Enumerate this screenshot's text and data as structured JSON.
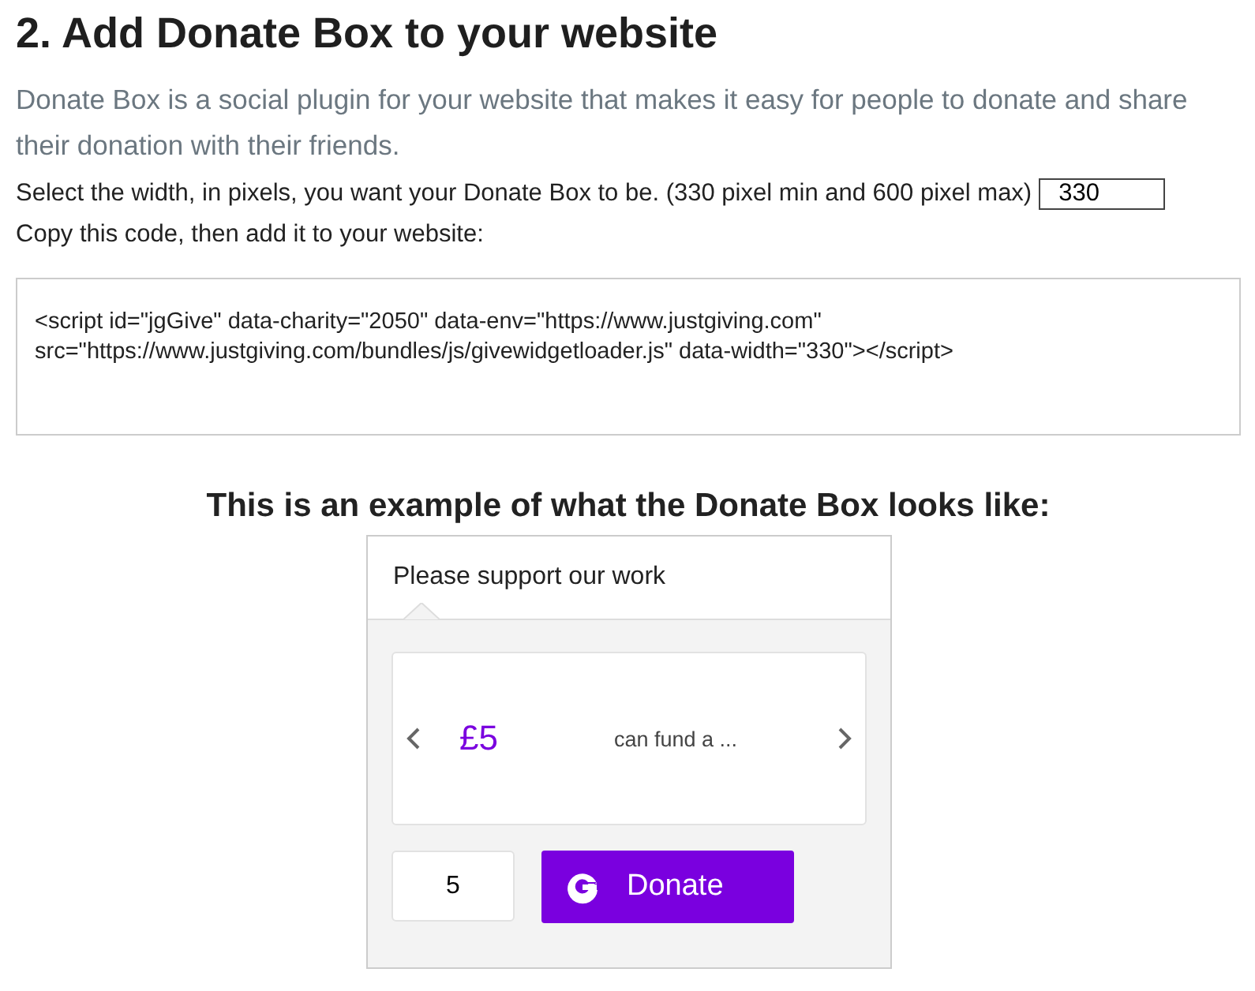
{
  "heading": "2. Add Donate Box to your website",
  "intro": "Donate Box is a social plugin for your website that makes it easy for people to donate and share their donation with their friends.",
  "width_label": "Select the width, in pixels, you want your Donate Box to be. (330 pixel min and 600 pixel max)",
  "width_value": "330",
  "copy_label": "Copy this code, then add it to your website:",
  "code": "<script id=\"jgGive\" data-charity=\"2050\" data-env=\"https://www.justgiving.com\"\nsrc=\"https://www.justgiving.com/bundles/js/givewidgetloader.js\" data-width=\"330\"></script>",
  "example_heading": "This is an example of what the Donate Box looks like:",
  "widget": {
    "title": "Please support our work",
    "amount": "£5",
    "description": "can fund a ...",
    "amount_value": "5",
    "donate_label": "Donate"
  }
}
